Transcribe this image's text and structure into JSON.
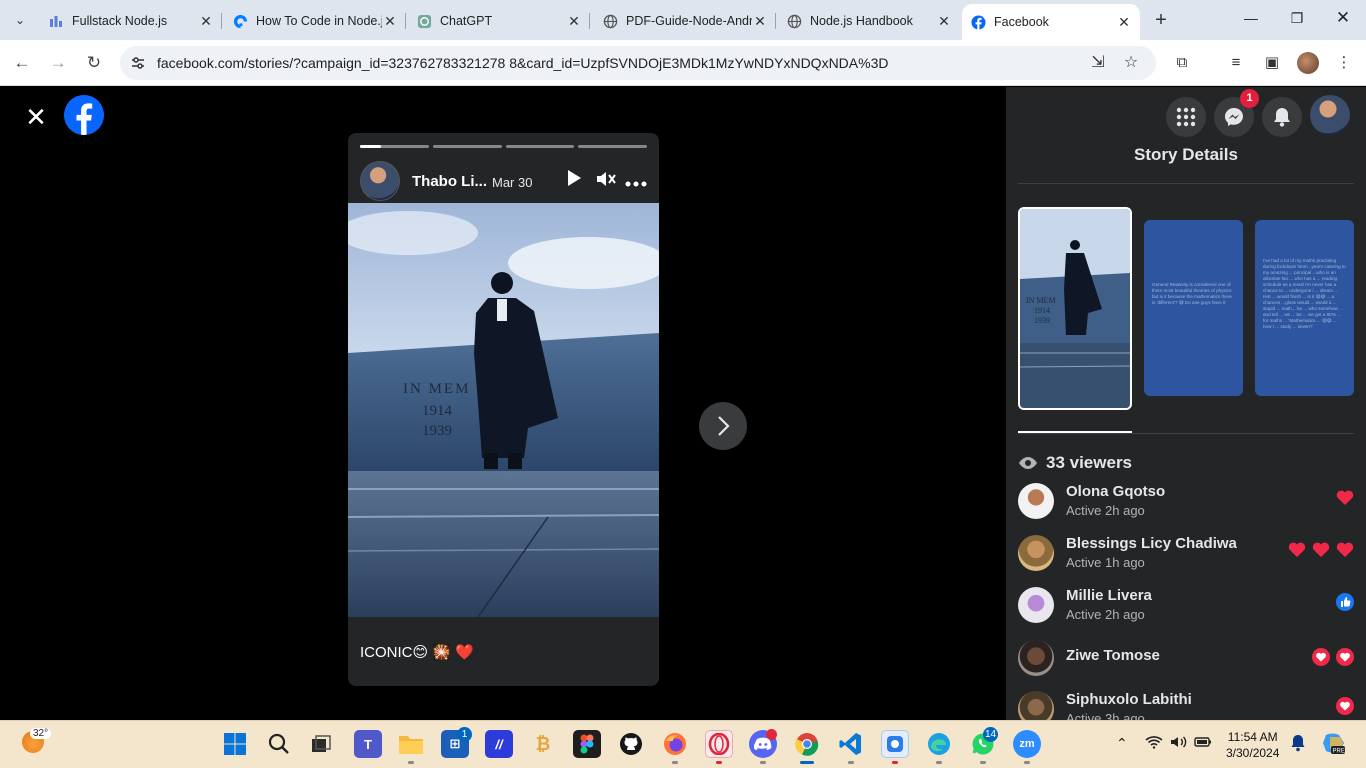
{
  "browser": {
    "tabs": [
      {
        "title": "Fullstack Node.js",
        "icon": "bar-chart-icon"
      },
      {
        "title": "How To Code in Node.js",
        "icon": "digitalocean-icon"
      },
      {
        "title": "ChatGPT",
        "icon": "chatgpt-icon"
      },
      {
        "title": "PDF-Guide-Node-Andrew",
        "icon": "globe-icon"
      },
      {
        "title": "Node.js Handbook",
        "icon": "globe-icon"
      },
      {
        "title": "Facebook",
        "icon": "facebook-icon"
      }
    ],
    "active_tab": 5,
    "url": "facebook.com/stories/?campaign_id=323762783321278 8&card_id=UzpfSVNDOjE3MDk1MzYwNDYxNDQxNDA%3D"
  },
  "story": {
    "author": "Thabo Li...",
    "date": "Mar 30",
    "caption": "ICONIC😊 🎇 ❤️",
    "segments": 4,
    "current_segment": 0,
    "current_progress": 0.3
  },
  "panel": {
    "title": "Story Details",
    "messenger_badge": "1",
    "viewers_count_label": "33 viewers",
    "thumb2_text": "General Relativity is considered one of them most beautiful theories of physics but is it because the mathematics there is 'different'? 😅 Do one guys have it",
    "thumb3_text": "I've had a lot of my maths practising during lockdown hmm ..yearn catering to my amazing ... principal ...who is an absolute fan ... who has a ... reading schedule as a result i'm never has a chance to ... undergone i ... dream ... rest ... would finish ... is it 😅😅 ... a chances ...gloss would ... would a ... stupid ... math... be ... who somehow ... and tell ... we ... be ... we get a 80% ... for maths ... 'Mathematics ... 😅😅 ... how I ... study ... seven?",
    "viewers": [
      {
        "name": "Olona Gqotso",
        "status": "Active 2h ago",
        "reactions": [
          "heart"
        ]
      },
      {
        "name": "Blessings Licy Chadiwa",
        "status": "Active 1h ago",
        "reactions": [
          "heart",
          "heart",
          "heart"
        ]
      },
      {
        "name": "Millie Livera",
        "status": "Active 2h ago",
        "reactions": [
          "like"
        ]
      },
      {
        "name": "Ziwe Tomose",
        "status": "",
        "reactions": [
          "heart-circle",
          "heart-circle"
        ]
      },
      {
        "name": "Siphuxolo Labithi",
        "status": "Active 3h ago",
        "reactions": [
          "heart-circle"
        ]
      }
    ]
  },
  "taskbar": {
    "weather_temp": "32°",
    "time": "11:54 AM",
    "date": "3/30/2024",
    "teams_badge": "",
    "store_badge": "1",
    "whatsapp_badge": "14"
  },
  "colors": {
    "facebook_blue": "#0866ff",
    "panel_bg": "#242526",
    "heart_red": "#f02849",
    "taskbar": "#f3e6cc"
  }
}
